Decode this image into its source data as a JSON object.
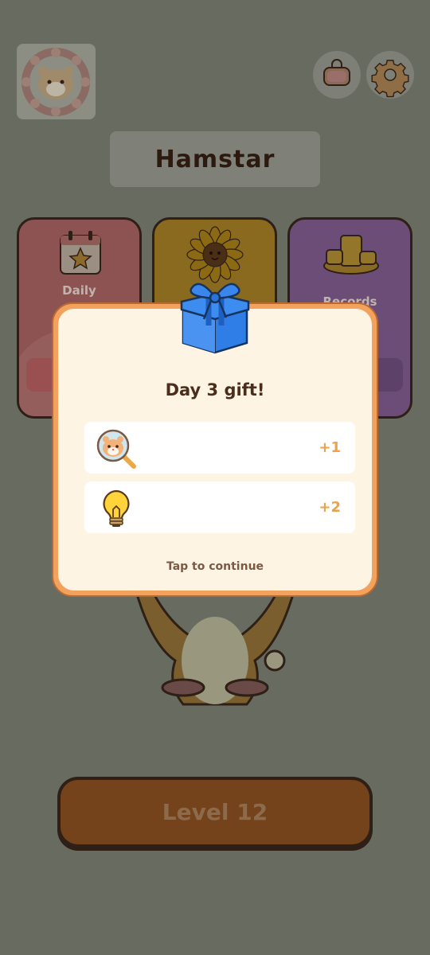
{
  "header": {
    "title": "Hamstar",
    "avatar_icon": "hamster-wreath-icon",
    "shop_icon": "bag-icon",
    "settings_icon": "gear-icon"
  },
  "cards": {
    "daily_label": "Daily",
    "sunflower_icon": "sunflower-icon",
    "records_label": "Records"
  },
  "play": {
    "level_label": "Level 12"
  },
  "popup": {
    "title": "Day 3 gift!",
    "rewards": [
      {
        "icon": "hamster-magnifier-icon",
        "amount": "+1"
      },
      {
        "icon": "lightbulb-icon",
        "amount": "+2"
      }
    ],
    "continue_label": "Tap to continue"
  },
  "colors": {
    "overlay": "#686c60",
    "popup_border": "#f3a25e",
    "popup_bg": "#fdf4e4",
    "amount": "#eaa24b",
    "gift_blue": "#2f7ee8"
  }
}
